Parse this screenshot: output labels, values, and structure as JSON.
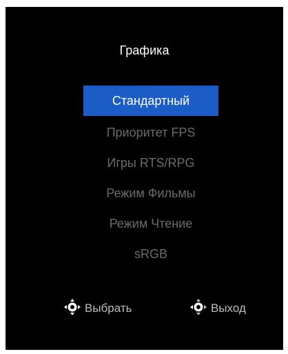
{
  "osd": {
    "title": "Графика",
    "selected_index": 0,
    "menu_items": [
      "Стандартный",
      "Приоритет FPS",
      "Игры RTS/RPG",
      "Режим Фильмы",
      "Режим Чтение",
      "sRGB"
    ],
    "hints": [
      {
        "icon": "joystick-select-icon",
        "label": "Выбрать"
      },
      {
        "icon": "joystick-exit-icon",
        "label": "Выход"
      }
    ],
    "colors": {
      "background": "#000000",
      "selection": "#1c5cc6",
      "text_active": "#ffffff",
      "text_inactive": "#6b6b6b"
    }
  }
}
